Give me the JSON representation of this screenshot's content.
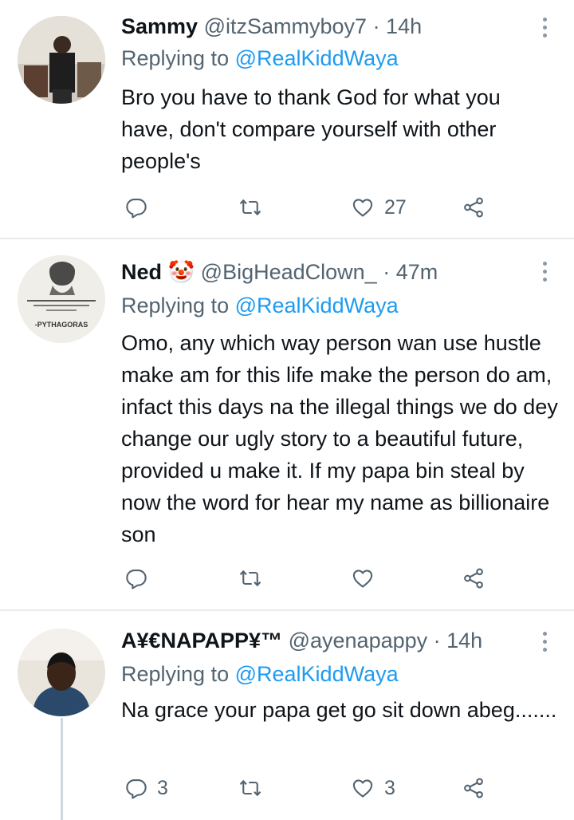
{
  "tweets": [
    {
      "name": "Sammy",
      "emoji": "",
      "handle": "@itzSammyboy7",
      "time": "· 14h",
      "replying_label": "Replying to",
      "replying_to": "@RealKiddWaya",
      "text": "Bro you have to thank God for what you have, don't compare yourself with other people's",
      "reply_count": "",
      "retweet_count": "",
      "like_count": "27"
    },
    {
      "name": "Ned",
      "emoji": "🤡",
      "handle": "@BigHeadClown_",
      "time": "· 47m",
      "replying_label": "Replying to",
      "replying_to": "@RealKiddWaya",
      "text": "Omo, any which way person wan use hustle make am for this life make the person do am, infact this days na the illegal things we do dey change our ugly story to a beautiful future, provided u make it. If my papa bin steal by now the word for hear my name as billionaire son",
      "avatar_caption": "-PYTHAGORAS",
      "reply_count": "",
      "retweet_count": "",
      "like_count": ""
    },
    {
      "name": "A¥€NAPAPP¥™",
      "emoji": "",
      "handle": "@ayenapappy",
      "time": "· 14h",
      "replying_label": "Replying to",
      "replying_to": "@RealKiddWaya",
      "text": "Na grace your papa get go sit down abeg.......",
      "reply_count": "3",
      "retweet_count": "",
      "like_count": "3"
    }
  ],
  "colors": {
    "accent": "#1d9bf0",
    "muted": "#536471",
    "text": "#0f1419",
    "divider": "#e7ebee"
  },
  "icons": [
    "reply-icon",
    "retweet-icon",
    "like-icon",
    "share-icon",
    "more-icon"
  ]
}
